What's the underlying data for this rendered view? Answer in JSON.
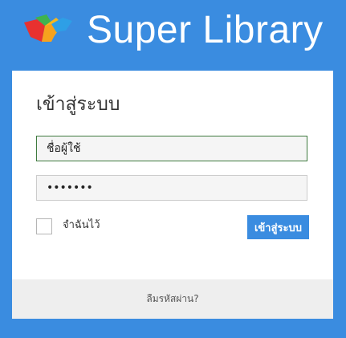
{
  "header": {
    "app_title": "Super Library",
    "logo_icon": "open-book-icon"
  },
  "login": {
    "title": "เข้าสู่ระบบ",
    "username_placeholder": "ชื่อผู้ใช้",
    "password_value": "•••••••",
    "remember_label": "จำฉันไว้",
    "remember_checked": false,
    "submit_label": "เข้าสู่ระบบ",
    "forgot_link": "ลืมรหัสผ่าน?"
  },
  "colors": {
    "brand_blue": "#3a8ce0",
    "card_bg": "#ffffff",
    "footer_bg": "#eeeeee",
    "focus_border": "#3e7a3e"
  }
}
